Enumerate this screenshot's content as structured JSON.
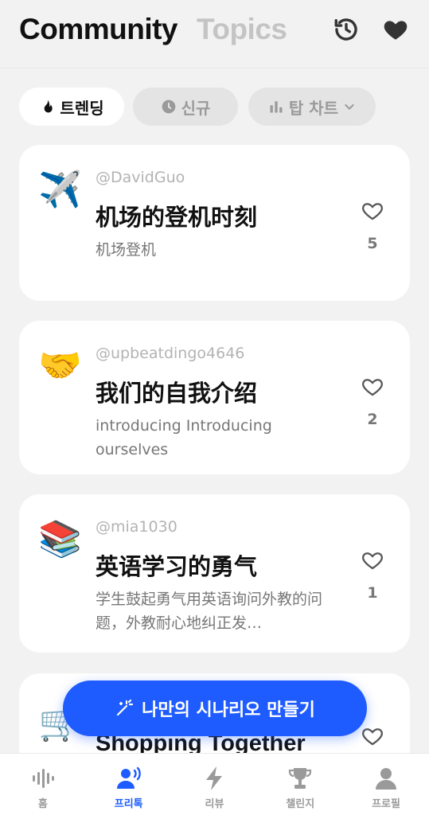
{
  "header": {
    "title_active": "Community",
    "title_inactive": "Topics",
    "icons": [
      "history-icon",
      "heart-icon"
    ]
  },
  "filters": [
    {
      "label": "트렌딩",
      "icon": "fire-icon",
      "active": true
    },
    {
      "label": "신규",
      "icon": "clock-icon",
      "active": false
    },
    {
      "label": "탑 차트",
      "icon": "bar-chart-icon",
      "active": false
    }
  ],
  "cards": [
    {
      "emoji": "✈️",
      "author": "@DavidGuo",
      "title": "机场的登机时刻",
      "desc": "机场登机",
      "likes": "5"
    },
    {
      "emoji": "🤝",
      "author": "@upbeatdingo4646",
      "title": "我们的自我介绍",
      "desc": "introducing Introducing ourselves",
      "likes": "2"
    },
    {
      "emoji": "📚",
      "author": "@mia1030",
      "title": "英语学习的勇气",
      "desc": "学生鼓起勇气用英语询问外教的问题，外教耐心地纠正发…",
      "likes": "1"
    },
    {
      "emoji": "🛒",
      "author": "",
      "title": "Shopping Together",
      "desc": "",
      "likes": ""
    }
  ],
  "fab": {
    "label": "나만의 시나리오 만들기",
    "icon": "magic-wand-icon"
  },
  "tabs": [
    {
      "label": "홈",
      "icon": "waveform-icon",
      "active": false
    },
    {
      "label": "프리톡",
      "icon": "speaking-person-icon",
      "active": true
    },
    {
      "label": "리뷰",
      "icon": "lightning-icon",
      "active": false
    },
    {
      "label": "챌린지",
      "icon": "trophy-icon",
      "active": false
    },
    {
      "label": "프로필",
      "icon": "person-icon",
      "active": false
    }
  ],
  "colors": {
    "accent": "#1f5cff",
    "background": "#f2f2f2",
    "card": "#ffffff",
    "muted": "#9a9a9a"
  }
}
